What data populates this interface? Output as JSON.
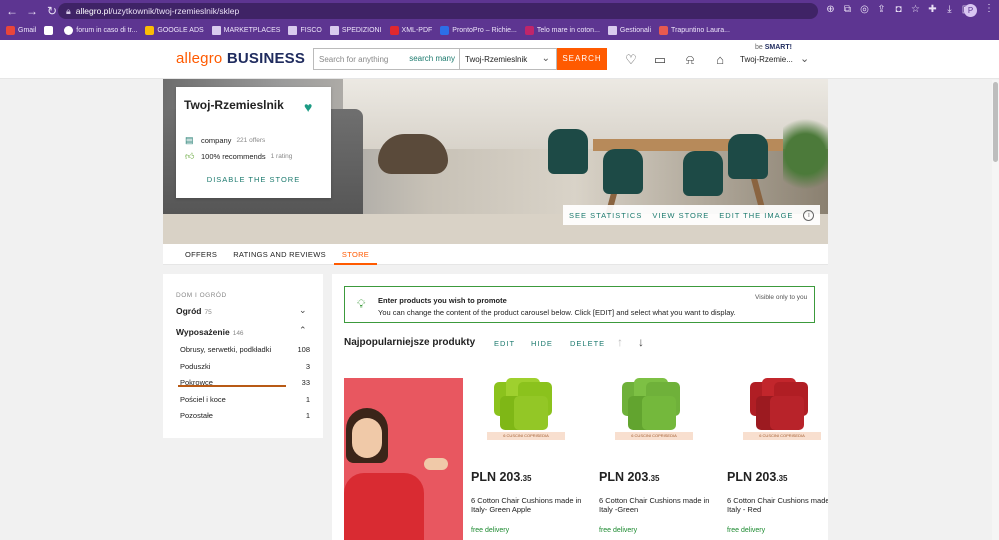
{
  "browser": {
    "url_host": "allegro.pl",
    "url_path": "/uzytkownik/twoj-rzemieslnik/sklep",
    "profile_initial": "P",
    "bookmarks": [
      {
        "label": "Gmail"
      },
      {
        "label": ""
      },
      {
        "label": "forum in caso di tr..."
      },
      {
        "label": "GOOGLE ADS"
      },
      {
        "label": "MARKETPLACES"
      },
      {
        "label": "FISCO"
      },
      {
        "label": "SPEDIZIONI"
      },
      {
        "label": "XML-PDF"
      },
      {
        "label": "ProntoPro – Richie..."
      },
      {
        "label": "Telo mare in coton..."
      },
      {
        "label": "Gestionali"
      },
      {
        "label": "Trapuntino Laura..."
      }
    ]
  },
  "header": {
    "logo_allegro": "allegro",
    "logo_business": "BUSINESS",
    "search_placeholder": "Search for anything",
    "search_many": "search many",
    "search_scope": "Twoj-Rzemieslnik",
    "search_button": "SEARCH",
    "smart_prefix": "be",
    "smart_label": "SMART!",
    "user_name": "Twoj-Rzemie..."
  },
  "store_card": {
    "name": "Twoj-Rzemieslnik",
    "type_label": "company",
    "offers": "221 offers",
    "recommend": "100% recommends",
    "rating": "1 rating",
    "disable": "DISABLE THE STORE"
  },
  "cover_actions": {
    "see_stats": "SEE STATISTICS",
    "view_store": "VIEW STORE",
    "edit_image": "EDIT THE IMAGE"
  },
  "tabs": [
    {
      "label": "OFFERS",
      "active": false
    },
    {
      "label": "RATINGS AND REVIEWS",
      "active": false
    },
    {
      "label": "STORE",
      "active": true
    }
  ],
  "sidebar": {
    "crumb": "DOM I OGRÓD",
    "cat1": {
      "label": "Ogród",
      "count": "75"
    },
    "cat2": {
      "label": "Wyposażenie",
      "count": "146"
    },
    "items": [
      {
        "label": "Obrusy, serwetki, podkładki",
        "count": "108"
      },
      {
        "label": "Poduszki",
        "count": "3"
      },
      {
        "label": "Pokrowce",
        "count": "33"
      },
      {
        "label": "Pościel i koce",
        "count": "1"
      },
      {
        "label": "Pozostałe",
        "count": "1"
      }
    ]
  },
  "promo": {
    "title": "Enter products you wish to promote",
    "text": "You can change the content of the product carousel below. Click [EDIT] and select what you want to display.",
    "visibility": "Visible only to you"
  },
  "carousel": {
    "title": "Najpopularniejsze produkty",
    "edit": "EDIT",
    "hide": "HIDE",
    "delete": "DELETE"
  },
  "products": [
    {
      "price_main": "PLN 203",
      "price_cents": ".35",
      "title_line1": "6 Cotton Chair Cushions made in",
      "title_line2": "Italy- Green Apple",
      "delivery": "free delivery",
      "color": "#8bc21d",
      "label": "6 CUSCINI COPRISEDIA"
    },
    {
      "price_main": "PLN 203",
      "price_cents": ".35",
      "title_line1": "6 Cotton Chair Cushions made in",
      "title_line2": "Italy -Green",
      "delivery": "free delivery",
      "color": "#6fb13a",
      "label": "6 CUSCINI COPRISEDIA"
    },
    {
      "price_main": "PLN 203",
      "price_cents": ".35",
      "title_line1": "6 Cotton Chair Cushions made in",
      "title_line2": "Italy - Red",
      "delivery": "free delivery",
      "color": "#b01e24",
      "label": "6 CUSCINI COPRISEDIA"
    }
  ]
}
